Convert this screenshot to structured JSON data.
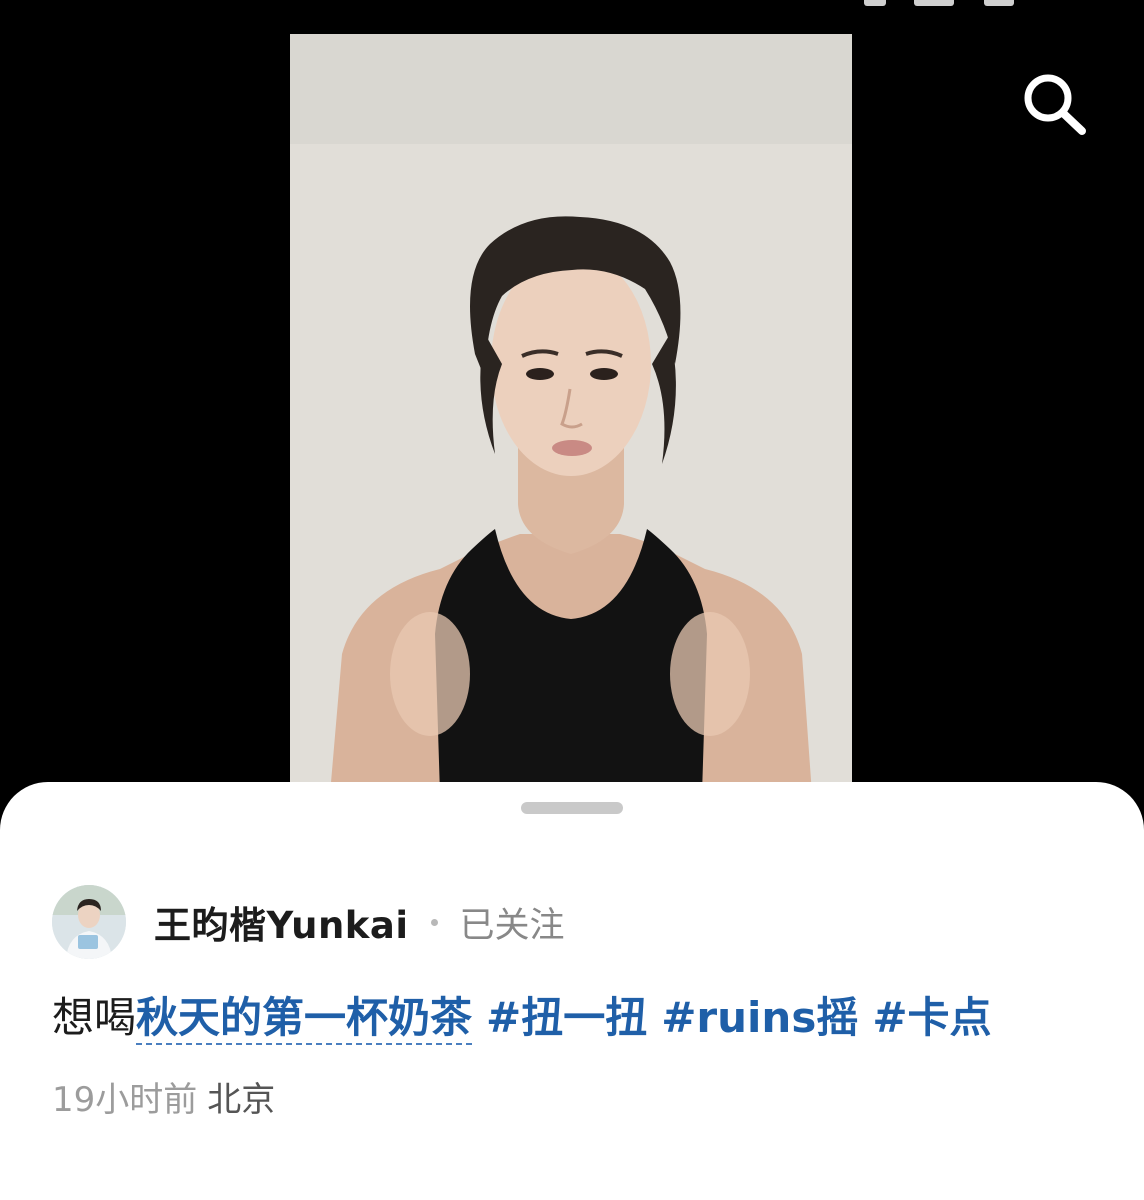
{
  "video": {
    "background": "#000000"
  },
  "toolbar": {
    "search_icon": "search-icon"
  },
  "post": {
    "author_name": "王昀楷Yunkai",
    "follow_status": "已关注",
    "caption": {
      "prefix": "想喝",
      "link_text": "秋天的第一杯奶茶",
      "hashtags": [
        "#扭一扭",
        "#ruins摇",
        "#卡点"
      ]
    },
    "time": "19小时前",
    "location": "北京"
  },
  "colors": {
    "link": "#1f5fa8",
    "meta": "#9c9c9c",
    "sheet": "#ffffff"
  }
}
